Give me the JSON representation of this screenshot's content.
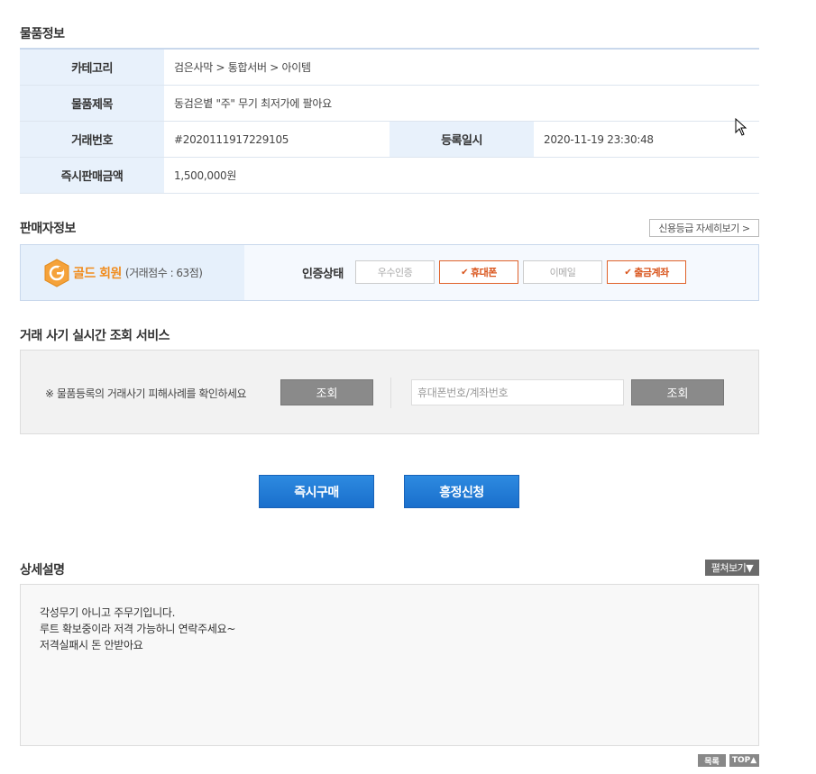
{
  "product_section": {
    "title": "물품정보",
    "category_label": "카테고리",
    "category_value": "검은사막 > 통합서버 > 아이템",
    "item_title_label": "물품제목",
    "item_title_value": "동검은볕 \"주\" 무기 최저가에 팔아요",
    "trade_no_label": "거래번호",
    "trade_no_value": "#2020111917229105",
    "reg_date_label": "등록일시",
    "reg_date_value": "2020-11-19 23:30:48",
    "price_label": "즉시판매금액",
    "price_value": "1,500,000원"
  },
  "seller_section": {
    "title": "판매자정보",
    "credit_button": "신용등급 자세히보기 >",
    "grade": "골드 회원",
    "score": "(거래점수 : 63점)",
    "auth_label": "인증상태",
    "auth_items": [
      {
        "label": "우수인증",
        "active": false
      },
      {
        "label": "휴대폰",
        "active": true
      },
      {
        "label": "이메일",
        "active": false
      },
      {
        "label": "출금계좌",
        "active": true
      }
    ]
  },
  "fraud_section": {
    "title": "거래 사기 실시간 조회 서비스",
    "notice": "※ 물품등록의 거래사기 피해사례를 확인하세요",
    "check_button_1": "조회",
    "input_placeholder": "휴대폰번호/계좌번호",
    "check_button_2": "조회"
  },
  "actions": {
    "buy_now": "즉시구매",
    "negotiate": "흥정신청"
  },
  "detail_section": {
    "title": "상세설명",
    "expand_button": "펼쳐보기▼",
    "lines": [
      "각성무기 아니고 주무기입니다.",
      "루트 확보중이라 저격 가능하니 연락주세요~",
      "저격실패시 돈 안받아요"
    ]
  },
  "footer": {
    "list_button": "목록",
    "top_button": "TOP▲"
  },
  "colors": {
    "accent_blue": "#1a6fcc",
    "label_bg": "#e8f1fb",
    "gold": "#f08c1e",
    "auth_active": "#d9541b"
  }
}
